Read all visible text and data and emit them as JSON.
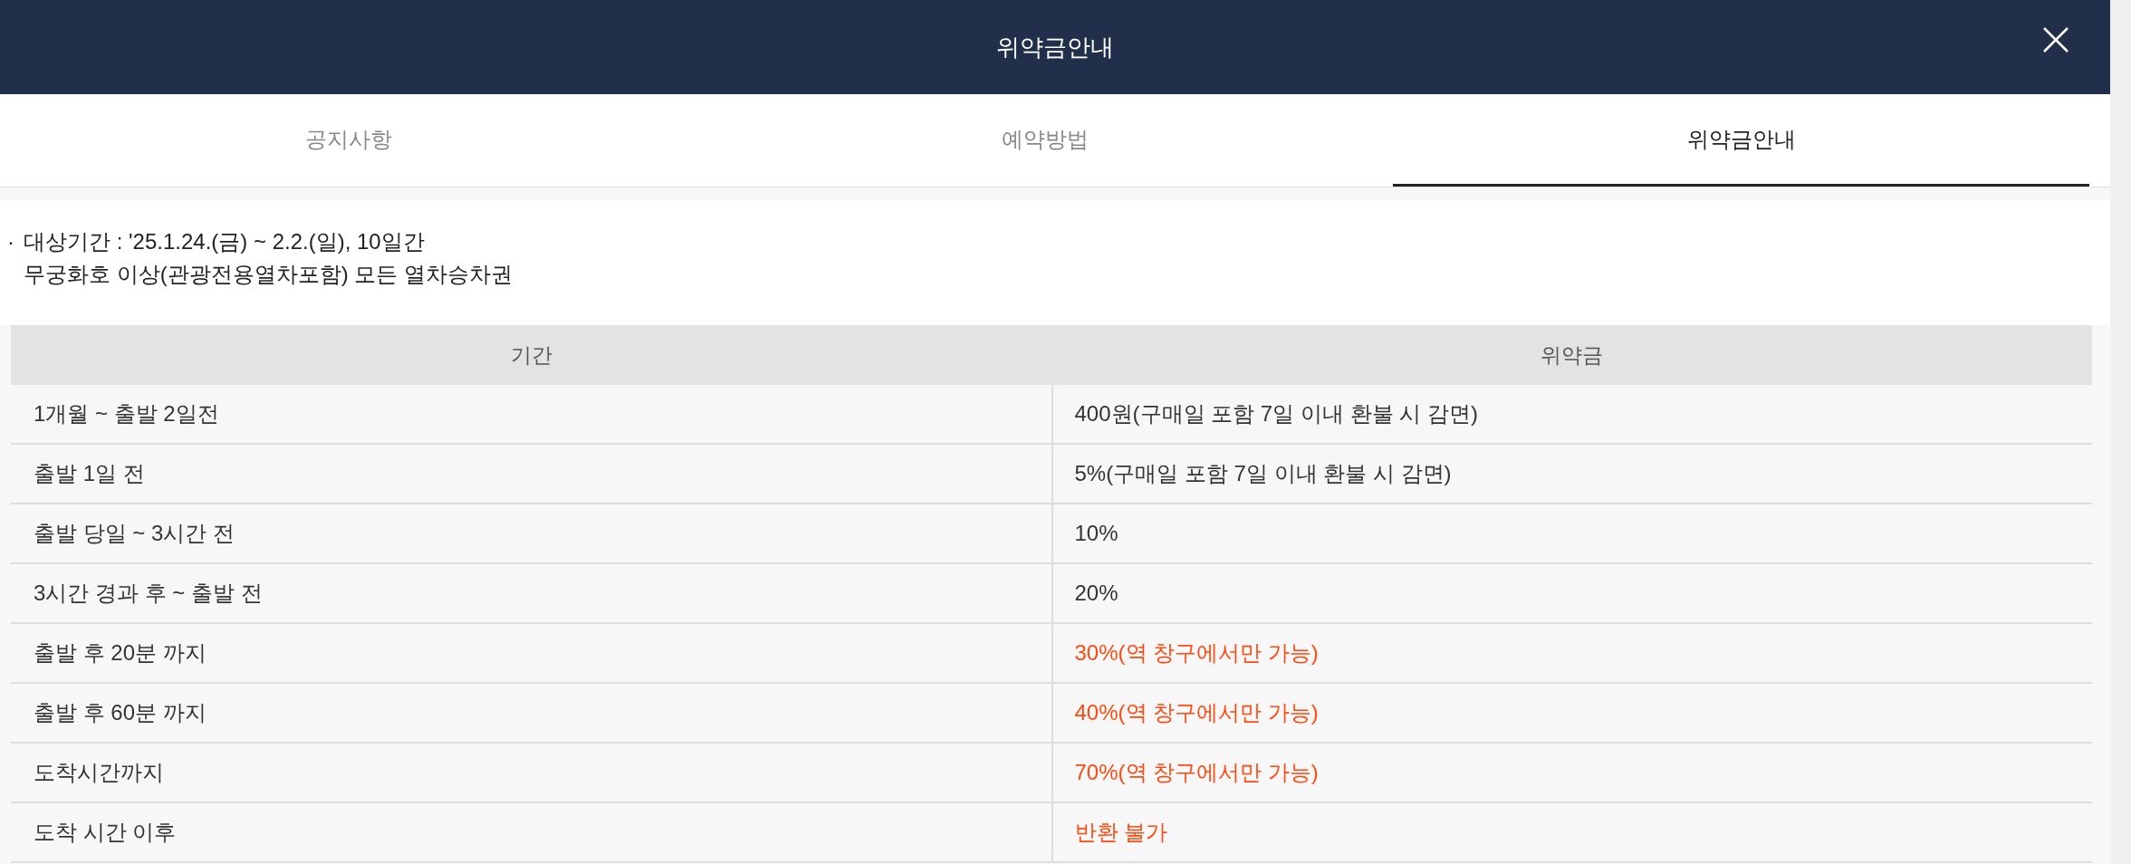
{
  "header": {
    "title": "위약금안내"
  },
  "tabs": [
    {
      "label": "공지사항",
      "selected": false
    },
    {
      "label": "예약방법",
      "selected": false
    },
    {
      "label": "위약금안내",
      "selected": true
    }
  ],
  "notice": {
    "bullet": "·",
    "lines": [
      "대상기간 : '25.1.24.(금) ~ 2.2.(일), 10일간",
      "무궁화호 이상(관광전용열차포함) 모든 열차승차권"
    ]
  },
  "table": {
    "columns": [
      "기간",
      "위약금"
    ],
    "rows": [
      {
        "period": "1개월 ~ 출발 2일전",
        "penalty": "400원(구매일 포함 7일 이내 환불 시 감면)",
        "emphasis": false
      },
      {
        "period": "출발 1일 전",
        "penalty": "5%(구매일 포함 7일 이내 환불 시 감면)",
        "emphasis": false
      },
      {
        "period": "출발 당일 ~ 3시간 전",
        "penalty": "10%",
        "emphasis": false
      },
      {
        "period": "3시간 경과 후 ~ 출발 전",
        "penalty": "20%",
        "emphasis": false
      },
      {
        "period": "출발 후 20분 까지",
        "penalty": "30%(역 창구에서만 가능)",
        "emphasis": true
      },
      {
        "period": "출발 후 60분 까지",
        "penalty": "40%(역 창구에서만 가능)",
        "emphasis": true
      },
      {
        "period": "도착시간까지",
        "penalty": "70%(역 창구에서만 가능)",
        "emphasis": true
      },
      {
        "period": "도착 시간 이후",
        "penalty": "반환 불가",
        "emphasis": true
      }
    ]
  }
}
